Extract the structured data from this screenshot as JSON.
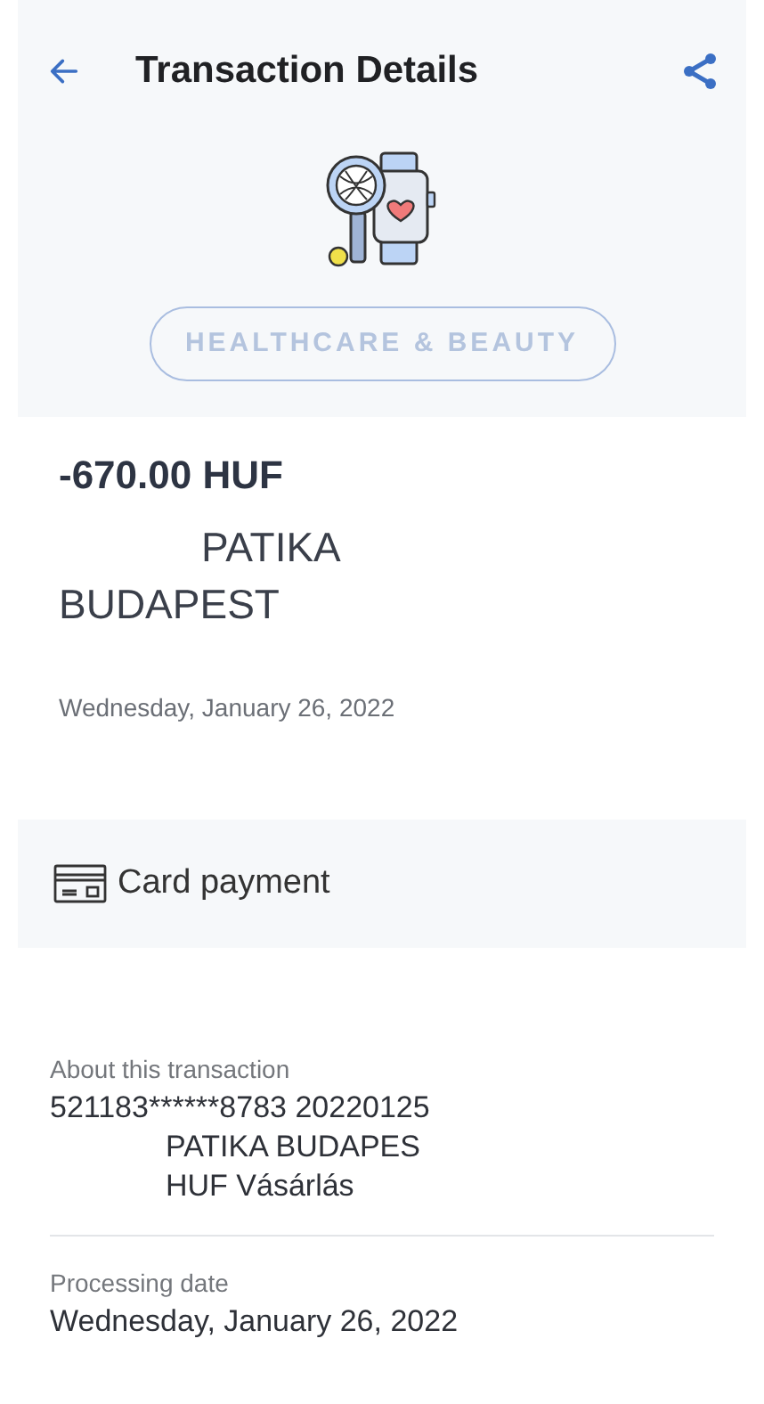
{
  "header": {
    "title": "Transaction Details",
    "category": "HEALTHCARE & BEAUTY"
  },
  "summary": {
    "amount": "-670.00 HUF",
    "merchant_lines": [
      "PATIKA",
      "BUDAPEST"
    ],
    "date": "Wednesday, January 26, 2022"
  },
  "payment_method": {
    "label": "Card payment"
  },
  "details": [
    {
      "label": "About this transaction",
      "lines": [
        "521183******8783 20220125",
        "PATIKA BUDAPES",
        "HUF Vásárlás"
      ]
    },
    {
      "label": "Processing date",
      "lines": [
        "Wednesday, January 26, 2022"
      ]
    }
  ]
}
